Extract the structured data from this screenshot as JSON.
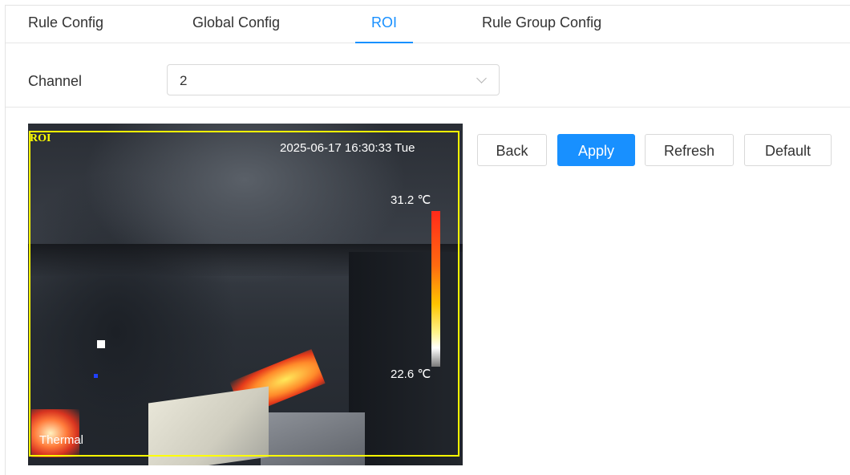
{
  "tabs": [
    {
      "label": "Rule Config",
      "active": false
    },
    {
      "label": "Global Config",
      "active": false
    },
    {
      "label": "ROI",
      "active": true
    },
    {
      "label": "Rule Group Config",
      "active": false
    }
  ],
  "channel": {
    "label": "Channel",
    "value": "2"
  },
  "video": {
    "roi_label": "ROI",
    "timestamp": "2025-06-17 16:30:33 Tue",
    "temp_max": "31.2 ℃",
    "temp_min": "22.6 ℃",
    "mode": "Thermal"
  },
  "buttons": {
    "back": "Back",
    "apply": "Apply",
    "refresh": "Refresh",
    "default": "Default"
  },
  "colors": {
    "accent": "#1890ff",
    "roi": "#ffff00"
  },
  "icons": {
    "select_arrow": "chevron-down-icon"
  }
}
